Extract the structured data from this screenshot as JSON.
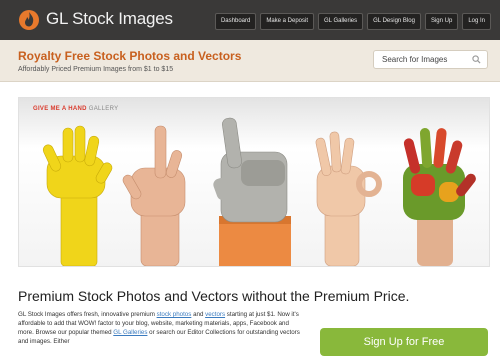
{
  "brand": {
    "name": "GL Stock Images",
    "logo_icon": "flame-icon"
  },
  "nav": [
    {
      "label": "Dashboard"
    },
    {
      "label": "Make a Deposit"
    },
    {
      "label": "GL Galleries"
    },
    {
      "label": "GL Design Blog"
    },
    {
      "label": "Sign Up"
    },
    {
      "label": "Log In"
    }
  ],
  "headband": {
    "title": "Royalty Free Stock Photos and Vectors",
    "subtitle": "Affordably Priced Premium Images from $1 to $15"
  },
  "search": {
    "placeholder": "Search for Images",
    "icon": "search-icon"
  },
  "hero": {
    "tag_red": "GIVE ME A HAND",
    "tag_grey": "GALLERY"
  },
  "content": {
    "title": "Premium Stock Photos and Vectors without the Premium Price.",
    "p1": "GL Stock Images offers fresh, innovative premium ",
    "link1": "stock photos",
    "p2": " and ",
    "link2": "vectors",
    "p3": " starting at just $1. Now it's affordable to add that WOW! factor to your blog, website, marketing materials, apps, Facebook and more. Browse our popular themed ",
    "link3": "GL Galleries",
    "p4": " or search our Editor Collections for outstanding vectors and images. Either"
  },
  "cta": {
    "label": "Sign Up for Free"
  },
  "colors": {
    "topbar": "#3a3938",
    "accent": "#c8601f",
    "cta": "#89b83b",
    "link": "#3b7bbf"
  }
}
